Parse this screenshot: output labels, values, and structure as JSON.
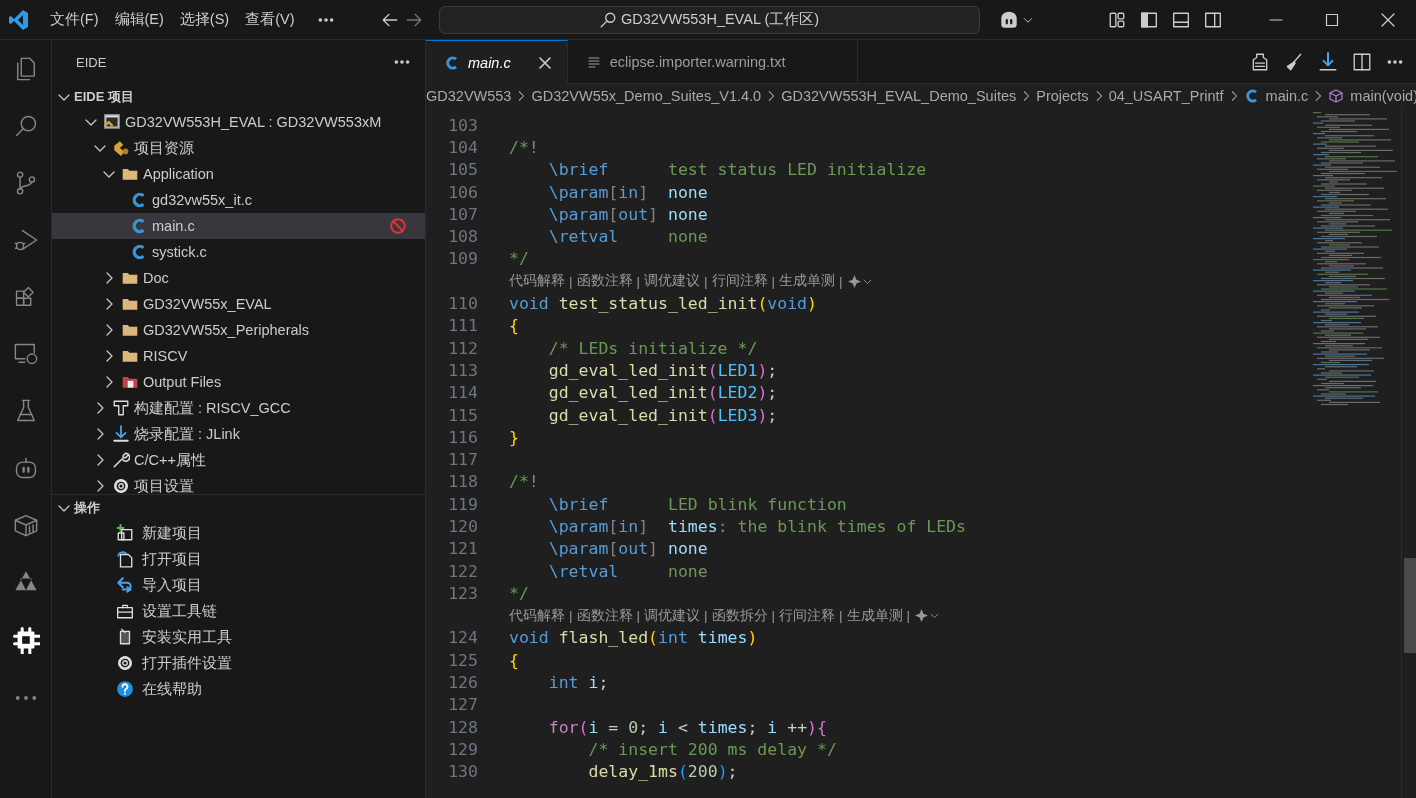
{
  "title_bar": {
    "menus": [
      "文件(F)",
      "编辑(E)",
      "选择(S)",
      "查看(V)"
    ],
    "search": "GD32VW553H_EVAL (工作区)"
  },
  "activity_bar": [
    {
      "kind": "explorer",
      "selected": false
    },
    {
      "kind": "search",
      "selected": false
    },
    {
      "kind": "scm",
      "selected": false
    },
    {
      "kind": "debug",
      "selected": false
    },
    {
      "kind": "extensions",
      "selected": false
    },
    {
      "kind": "remote",
      "selected": false
    },
    {
      "kind": "testing",
      "selected": false
    },
    {
      "kind": "robot",
      "selected": false
    },
    {
      "kind": "cube",
      "selected": false
    },
    {
      "kind": "knot",
      "selected": false
    },
    {
      "kind": "chip",
      "selected": true
    },
    {
      "kind": "more",
      "selected": false
    }
  ],
  "sidebar": {
    "title": "EIDE",
    "project_section": {
      "title": "EIDE 项目",
      "expanded": true,
      "items": [
        {
          "label": "GD32VW553H_EVAL : GD32VW553xM",
          "kind": "project",
          "expanded": true,
          "selected": false,
          "children": [
            {
              "label": "项目资源",
              "kind": "sources",
              "expanded": true,
              "selected": false,
              "children": [
                {
                  "label": "Application",
                  "kind": "folder",
                  "expanded": true,
                  "selected": false,
                  "children": [
                    {
                      "label": "gd32vw55x_it.c",
                      "kind": "c-file",
                      "selected": false,
                      "excluded": false
                    },
                    {
                      "label": "main.c",
                      "kind": "c-file",
                      "selected": true,
                      "excluded": true
                    },
                    {
                      "label": "systick.c",
                      "kind": "c-file",
                      "selected": false,
                      "excluded": false
                    }
                  ]
                },
                {
                  "label": "Doc",
                  "kind": "folder",
                  "expanded": false,
                  "selected": false
                },
                {
                  "label": "GD32VW55x_EVAL",
                  "kind": "folder",
                  "expanded": false,
                  "selected": false
                },
                {
                  "label": "GD32VW55x_Peripherals",
                  "kind": "folder",
                  "expanded": false,
                  "selected": false
                },
                {
                  "label": "RISCV",
                  "kind": "folder",
                  "expanded": false,
                  "selected": false
                },
                {
                  "label": "Output Files",
                  "kind": "output",
                  "expanded": false,
                  "selected": false
                }
              ]
            },
            {
              "label": "构建配置 : RISCV_GCC",
              "kind": "build",
              "expanded": false,
              "selected": false
            },
            {
              "label": "烧录配置 : JLink",
              "kind": "flash",
              "expanded": false,
              "selected": false
            },
            {
              "label": "C/C++属性",
              "kind": "wrench",
              "expanded": false,
              "selected": false
            },
            {
              "label": "项目设置",
              "kind": "settings",
              "expanded": false,
              "selected": false
            }
          ]
        }
      ]
    },
    "actions_section": {
      "title": "操作",
      "expanded": true,
      "items": [
        {
          "label": "新建项目",
          "kind": "new"
        },
        {
          "label": "打开项目",
          "kind": "open"
        },
        {
          "label": "导入项目",
          "kind": "import"
        },
        {
          "label": "设置工具链",
          "kind": "toolbox"
        },
        {
          "label": "安装实用工具",
          "kind": "install"
        },
        {
          "label": "打开插件设置",
          "kind": "gear"
        },
        {
          "label": "在线帮助",
          "kind": "help"
        }
      ]
    }
  },
  "tabs": [
    {
      "label": "main.c",
      "kind": "c",
      "selected": true,
      "preview": true
    },
    {
      "label": "eclipse.importer.warning.txt",
      "kind": "text",
      "selected": false,
      "preview": false
    }
  ],
  "breadcrumb": [
    {
      "label": "GD32VW553",
      "kind": "folder"
    },
    {
      "label": "GD32VW55x_Demo_Suites_V1.4.0",
      "kind": "folder"
    },
    {
      "label": "GD32VW553H_EVAL_Demo_Suites",
      "kind": "folder"
    },
    {
      "label": "Projects",
      "kind": "folder"
    },
    {
      "label": "04_USART_Printf",
      "kind": "folder"
    },
    {
      "label": "main.c",
      "kind": "c-file"
    },
    {
      "label": "main(void)",
      "kind": "symbol"
    }
  ],
  "editor": {
    "separator": "|",
    "lines": [
      {
        "kind": "code",
        "num": "103"
      },
      {
        "kind": "code",
        "num": "104",
        "tokens": [
          {
            "text": "/*!",
            "kind": "comment"
          }
        ]
      },
      {
        "kind": "code",
        "num": "105",
        "tokens": [
          {
            "text": "    \\brief",
            "kind": "tag"
          },
          {
            "text": "      test status LED initialize",
            "kind": "comment"
          }
        ]
      },
      {
        "kind": "code",
        "num": "106",
        "tokens": [
          {
            "text": "    \\param",
            "kind": "tag"
          },
          {
            "text": "[",
            "kind": "punc"
          },
          {
            "text": "in",
            "kind": "tag"
          },
          {
            "text": "]",
            "kind": "punc"
          },
          {
            "text": "  none",
            "kind": "docvar"
          }
        ]
      },
      {
        "kind": "code",
        "num": "107",
        "tokens": [
          {
            "text": "    \\param",
            "kind": "tag"
          },
          {
            "text": "[",
            "kind": "punc"
          },
          {
            "text": "out",
            "kind": "tag"
          },
          {
            "text": "]",
            "kind": "punc"
          },
          {
            "text": " none",
            "kind": "docvar"
          }
        ]
      },
      {
        "kind": "code",
        "num": "108",
        "tokens": [
          {
            "text": "    \\retval",
            "kind": "tag"
          },
          {
            "text": "     none",
            "kind": "comment"
          }
        ]
      },
      {
        "kind": "code",
        "num": "109",
        "tokens": [
          {
            "text": "*/",
            "kind": "comment"
          }
        ]
      },
      {
        "kind": "lens",
        "items": [
          "代码解释",
          "函数注释",
          "调优建议",
          "行间注释",
          "生成单测"
        ]
      },
      {
        "kind": "code",
        "num": "110",
        "tokens": [
          {
            "text": "void",
            "kind": "kw"
          },
          {
            "text": " test_status_led_init",
            "kind": "fn"
          },
          {
            "text": "(",
            "kind": "brace1"
          },
          {
            "text": "void",
            "kind": "kw"
          },
          {
            "text": ")",
            "kind": "brace1"
          }
        ]
      },
      {
        "kind": "code",
        "num": "111",
        "tokens": [
          {
            "text": "{",
            "kind": "brace1"
          }
        ]
      },
      {
        "kind": "code",
        "num": "112",
        "tokens": [
          {
            "text": "    /* LEDs initialize */",
            "kind": "comment"
          }
        ]
      },
      {
        "kind": "code",
        "num": "113",
        "tokens": [
          {
            "text": "    gd_eval_led_init",
            "kind": "fn"
          },
          {
            "text": "(",
            "kind": "brace2"
          },
          {
            "text": "LED1",
            "kind": "const"
          },
          {
            "text": ")",
            "kind": "brace2"
          },
          {
            "text": ";",
            "kind": "plain"
          }
        ]
      },
      {
        "kind": "code",
        "num": "114",
        "tokens": [
          {
            "text": "    gd_eval_led_init",
            "kind": "fn"
          },
          {
            "text": "(",
            "kind": "brace2"
          },
          {
            "text": "LED2",
            "kind": "const"
          },
          {
            "text": ")",
            "kind": "brace2"
          },
          {
            "text": ";",
            "kind": "plain"
          }
        ]
      },
      {
        "kind": "code",
        "num": "115",
        "tokens": [
          {
            "text": "    gd_eval_led_init",
            "kind": "fn"
          },
          {
            "text": "(",
            "kind": "brace2"
          },
          {
            "text": "LED3",
            "kind": "const"
          },
          {
            "text": ")",
            "kind": "brace2"
          },
          {
            "text": ";",
            "kind": "plain"
          }
        ]
      },
      {
        "kind": "code",
        "num": "116",
        "tokens": [
          {
            "text": "}",
            "kind": "brace1"
          }
        ]
      },
      {
        "kind": "code",
        "num": "117"
      },
      {
        "kind": "code",
        "num": "118",
        "tokens": [
          {
            "text": "/*!",
            "kind": "comment"
          }
        ]
      },
      {
        "kind": "code",
        "num": "119",
        "tokens": [
          {
            "text": "    \\brief",
            "kind": "tag"
          },
          {
            "text": "      LED blink function",
            "kind": "comment"
          }
        ]
      },
      {
        "kind": "code",
        "num": "120",
        "tokens": [
          {
            "text": "    \\param",
            "kind": "tag"
          },
          {
            "text": "[",
            "kind": "punc"
          },
          {
            "text": "in",
            "kind": "tag"
          },
          {
            "text": "]",
            "kind": "punc"
          },
          {
            "text": "  times",
            "kind": "docvar"
          },
          {
            "text": ": the blink times of LEDs",
            "kind": "comment"
          }
        ]
      },
      {
        "kind": "code",
        "num": "121",
        "tokens": [
          {
            "text": "    \\param",
            "kind": "tag"
          },
          {
            "text": "[",
            "kind": "punc"
          },
          {
            "text": "out",
            "kind": "tag"
          },
          {
            "text": "]",
            "kind": "punc"
          },
          {
            "text": " none",
            "kind": "docvar"
          }
        ]
      },
      {
        "kind": "code",
        "num": "122",
        "tokens": [
          {
            "text": "    \\retval",
            "kind": "tag"
          },
          {
            "text": "     none",
            "kind": "comment"
          }
        ]
      },
      {
        "kind": "code",
        "num": "123",
        "tokens": [
          {
            "text": "*/",
            "kind": "comment"
          }
        ]
      },
      {
        "kind": "lens",
        "items": [
          "代码解释",
          "函数注释",
          "调优建议",
          "函数拆分",
          "行间注释",
          "生成单测"
        ]
      },
      {
        "kind": "code",
        "num": "124",
        "tokens": [
          {
            "text": "void",
            "kind": "kw"
          },
          {
            "text": " flash_led",
            "kind": "fn"
          },
          {
            "text": "(",
            "kind": "brace1"
          },
          {
            "text": "int",
            "kind": "kw"
          },
          {
            "text": " times",
            "kind": "var"
          },
          {
            "text": ")",
            "kind": "brace1"
          }
        ]
      },
      {
        "kind": "code",
        "num": "125",
        "tokens": [
          {
            "text": "{",
            "kind": "brace1"
          }
        ]
      },
      {
        "kind": "code",
        "num": "126",
        "tokens": [
          {
            "text": "    int",
            "kind": "kw"
          },
          {
            "text": " i",
            "kind": "var"
          },
          {
            "text": ";",
            "kind": "plain"
          }
        ]
      },
      {
        "kind": "code",
        "num": "127"
      },
      {
        "kind": "code",
        "num": "128",
        "tokens": [
          {
            "text": "    for",
            "kind": "ctl"
          },
          {
            "text": "(",
            "kind": "brace2"
          },
          {
            "text": "i",
            "kind": "var"
          },
          {
            "text": " = ",
            "kind": "plain"
          },
          {
            "text": "0",
            "kind": "num"
          },
          {
            "text": "; ",
            "kind": "plain"
          },
          {
            "text": "i",
            "kind": "var"
          },
          {
            "text": " < ",
            "kind": "plain"
          },
          {
            "text": "times",
            "kind": "var"
          },
          {
            "text": "; ",
            "kind": "plain"
          },
          {
            "text": "i",
            "kind": "var"
          },
          {
            "text": " ++",
            "kind": "plain"
          },
          {
            "text": ")",
            "kind": "brace2"
          },
          {
            "text": "{",
            "kind": "brace2"
          }
        ]
      },
      {
        "kind": "code",
        "num": "129",
        "tokens": [
          {
            "text": "        /* insert 200 ms delay */",
            "kind": "comment"
          }
        ]
      },
      {
        "kind": "code",
        "num": "130",
        "tokens": [
          {
            "text": "        delay_1ms",
            "kind": "fn"
          },
          {
            "text": "(",
            "kind": "brace3"
          },
          {
            "text": "200",
            "kind": "num"
          },
          {
            "text": ")",
            "kind": "brace3"
          },
          {
            "text": ";",
            "kind": "plain"
          }
        ]
      }
    ]
  }
}
